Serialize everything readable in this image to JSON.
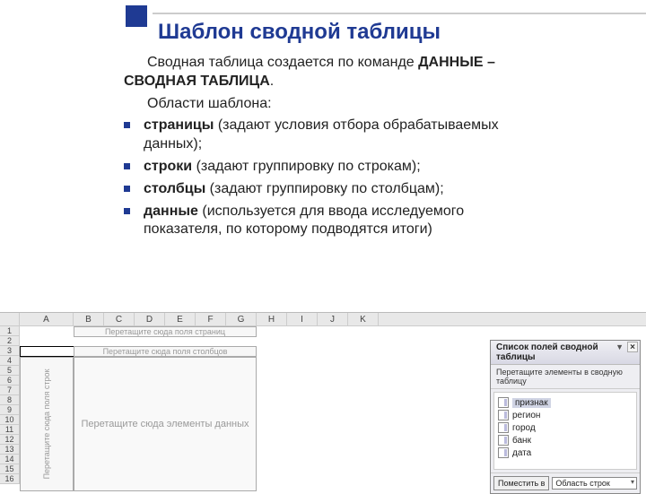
{
  "title": "Шаблон сводной таблицы",
  "intro_pre": "Сводная таблица создается по команде",
  "intro_cmd": "ДАННЫЕ – СВОДНАЯ ТАБЛИЦА",
  "intro_post": ".",
  "areas_heading": "Области шаблона:",
  "areas": [
    {
      "label": "страницы",
      "desc": " (задают условия отбора обрабатываемых данных);"
    },
    {
      "label": "строки",
      "desc": " (задают группировку по строкам);"
    },
    {
      "label": "столбцы",
      "desc": " (задают группировку по столбцам);"
    },
    {
      "label": "данные",
      "desc": " (используется для ввода исследуемого показателя, по которому подводятся итоги)"
    }
  ],
  "sheet": {
    "cols": [
      "A",
      "B",
      "C",
      "D",
      "E",
      "F",
      "G",
      "H",
      "I",
      "J",
      "K"
    ],
    "rows": [
      "1",
      "2",
      "3",
      "4",
      "5",
      "6",
      "7",
      "8",
      "9",
      "10",
      "11",
      "12",
      "13",
      "14",
      "15",
      "16"
    ],
    "page_zone": "Перетащите сюда поля страниц",
    "col_zone": "Перетащите сюда поля столбцов",
    "row_zone": "Перетащите сюда поля строк",
    "data_zone": "Перетащите сюда элементы данных"
  },
  "panel": {
    "title": "Список полей сводной таблицы",
    "instruction": "Перетащите элементы в сводную таблицу",
    "fields": [
      "признак",
      "регион",
      "город",
      "банк",
      "дата"
    ],
    "selected_index": 0,
    "btn_place": "Поместить в",
    "select_area": "Область строк"
  }
}
